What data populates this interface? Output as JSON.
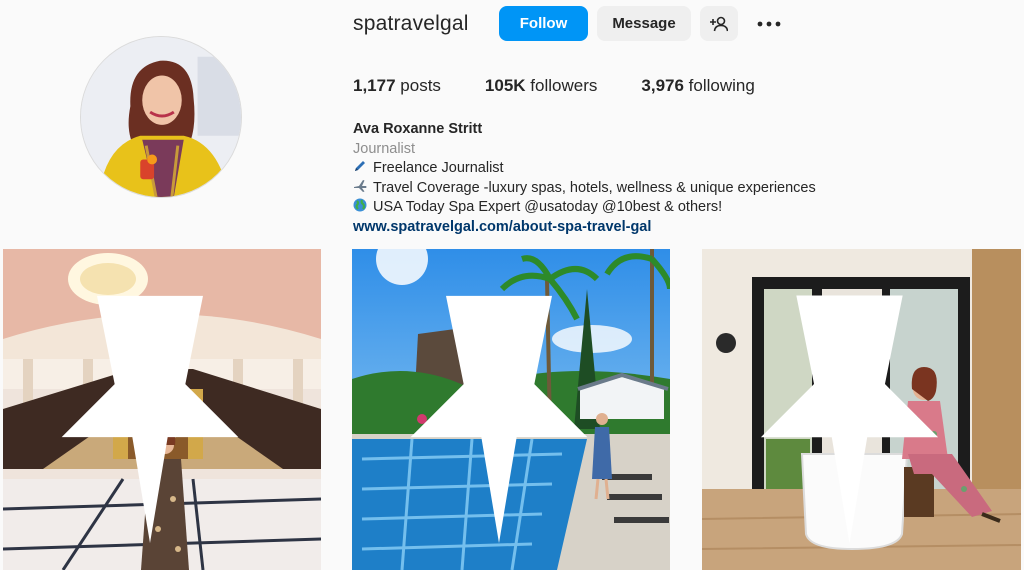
{
  "profile": {
    "username": "spatravelgal",
    "full_name": "Ava Roxanne Stritt",
    "category": "Journalist",
    "bio_lines": [
      {
        "icon": "pen-icon",
        "glyph": "🖋",
        "text": "Freelance Journalist"
      },
      {
        "icon": "airplane-icon",
        "glyph": "✈",
        "text": "Travel Coverage -luxury spas, hotels, wellness & unique experiences"
      },
      {
        "icon": "globe-icon",
        "glyph": "🌎",
        "text": "USA Today Spa Expert @usatoday @10best & others!"
      }
    ],
    "website": "www.spatravelgal.com/about-spa-travel-gal"
  },
  "actions": {
    "follow_label": "Follow",
    "message_label": "Message"
  },
  "stats": {
    "posts_count": "1,177",
    "posts_label": "posts",
    "followers_count": "105K",
    "followers_label": "followers",
    "following_count": "3,976",
    "following_label": "following"
  },
  "posts": [
    {
      "subject": "palace-staircase-photo",
      "pinned": true
    },
    {
      "subject": "resort-pool-photo",
      "pinned": true
    },
    {
      "subject": "bathroom-tub-photo",
      "pinned": true
    }
  ],
  "colors": {
    "accent": "#0095f6",
    "link": "#00376b",
    "muted": "#8e8e8e",
    "button_secondary": "#efefef"
  }
}
